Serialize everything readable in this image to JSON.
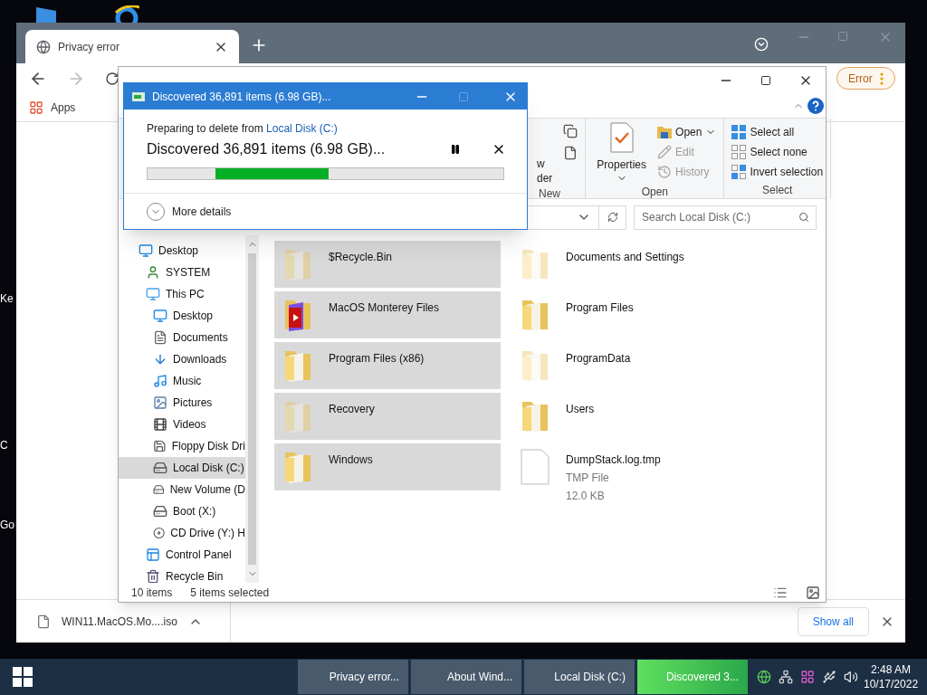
{
  "desktop": {
    "side_labels": [
      "Ke",
      "C",
      "Go"
    ]
  },
  "browser": {
    "tab": {
      "title": "Privacy error",
      "selected": true
    },
    "apps_label": "Apps",
    "error_chip": "Error",
    "download": {
      "filename": "WIN11.MacOS.Mo....iso"
    },
    "show_all": "Show all"
  },
  "explorer": {
    "ribbon": {
      "new_fragments": [
        "w",
        "der"
      ],
      "groups": [
        {
          "label": "New"
        },
        {
          "label": "Open",
          "items": [
            {
              "label": "Properties",
              "kind": "large",
              "disabled": false
            },
            {
              "label": "Open",
              "kind": "open",
              "disabled": false
            },
            {
              "label": "Edit",
              "kind": "edit",
              "disabled": true
            },
            {
              "label": "History",
              "kind": "history",
              "disabled": true
            }
          ]
        },
        {
          "label": "Select",
          "items": [
            {
              "label": "Select all",
              "kind": "select-all",
              "disabled": false
            },
            {
              "label": "Select none",
              "kind": "select-none",
              "disabled": false
            },
            {
              "label": "Invert selection",
              "kind": "invert",
              "disabled": false
            }
          ]
        }
      ]
    },
    "search": {
      "placeholder": "Search Local Disk (C:)"
    },
    "nav": [
      {
        "label": "Desktop",
        "kind": "desktop",
        "selected": false,
        "children": [
          {
            "label": "SYSTEM",
            "kind": "user",
            "selected": false
          },
          {
            "label": "This PC",
            "kind": "pc",
            "selected": false,
            "children": [
              {
                "label": "Desktop",
                "kind": "desktop",
                "selected": false
              },
              {
                "label": "Documents",
                "kind": "documents",
                "selected": false
              },
              {
                "label": "Downloads",
                "kind": "downloads",
                "selected": false
              },
              {
                "label": "Music",
                "kind": "music",
                "selected": false
              },
              {
                "label": "Pictures",
                "kind": "pictures",
                "selected": false
              },
              {
                "label": "Videos",
                "kind": "videos",
                "selected": false
              },
              {
                "label": "Floppy Disk Dri",
                "kind": "floppy",
                "selected": false
              },
              {
                "label": "Local Disk (C:)",
                "kind": "drive",
                "selected": true
              },
              {
                "label": "New Volume (D",
                "kind": "drive",
                "selected": false
              },
              {
                "label": "Boot (X:)",
                "kind": "drive",
                "selected": false
              },
              {
                "label": "CD Drive (Y:) H",
                "kind": "cd",
                "selected": false
              }
            ]
          },
          {
            "label": "Control Panel",
            "kind": "control",
            "selected": false
          },
          {
            "label": "Recycle Bin",
            "kind": "recycle",
            "selected": false
          }
        ]
      }
    ],
    "files": [
      {
        "name": "$Recycle.Bin",
        "kind": "folder",
        "hidden": true,
        "selected": true
      },
      {
        "name": "Documents and Settings",
        "kind": "folder",
        "hidden": true,
        "selected": false
      },
      {
        "name": "MacOS Monterey Files",
        "kind": "app-folder",
        "hidden": false,
        "selected": true
      },
      {
        "name": "Program Files",
        "kind": "folder",
        "hidden": false,
        "selected": false
      },
      {
        "name": "Program Files (x86)",
        "kind": "folder",
        "hidden": false,
        "selected": true
      },
      {
        "name": "ProgramData",
        "kind": "folder",
        "hidden": true,
        "selected": false
      },
      {
        "name": "Recovery",
        "kind": "folder",
        "hidden": true,
        "selected": true
      },
      {
        "name": "Users",
        "kind": "folder",
        "hidden": false,
        "selected": false
      },
      {
        "name": "Windows",
        "kind": "folder",
        "hidden": false,
        "selected": true
      },
      {
        "name": "DumpStack.log.tmp",
        "kind": "file",
        "selected": false,
        "type": "TMP File",
        "size": "12.0 KB"
      }
    ],
    "status": {
      "count": "10 items",
      "selection": "5 items selected"
    }
  },
  "dialog": {
    "title": "Discovered 36,891 items (6.98 GB)...",
    "intro": "Preparing to delete from",
    "link": "Local Disk (C:)",
    "marquee": true,
    "status": "Discovered 36,891 items (6.98 GB)...",
    "more": "More details"
  },
  "taskbar": {
    "buttons": [
      {
        "label": "Privacy error...",
        "progress": false
      },
      {
        "label": "About Wind...",
        "progress": false
      },
      {
        "label": "Local Disk (C:)",
        "progress": false
      },
      {
        "label": "Discovered 3...",
        "progress": true
      }
    ],
    "time": "2:48 AM",
    "date": "10/17/2022"
  }
}
